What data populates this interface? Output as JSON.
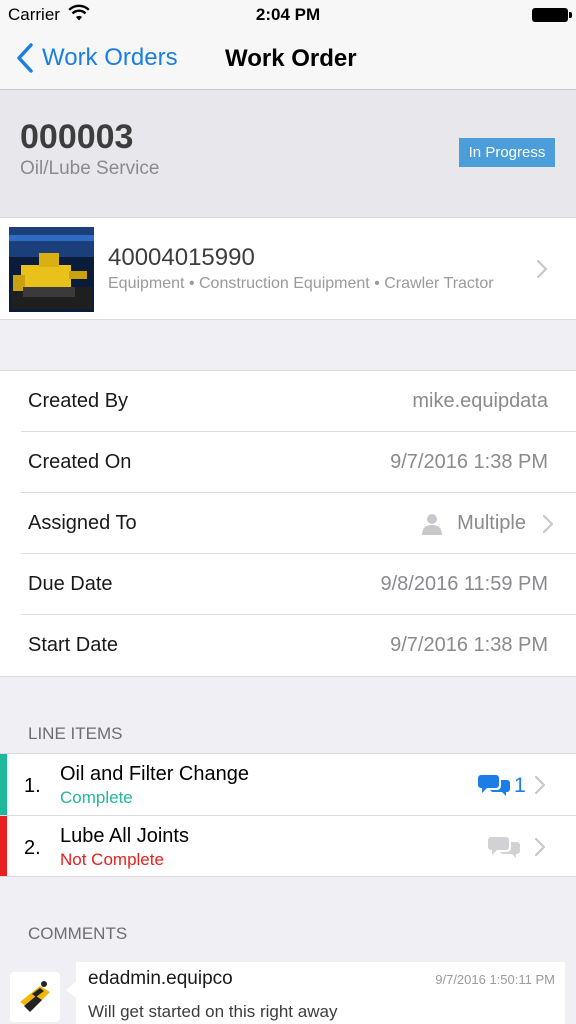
{
  "status_bar": {
    "carrier": "Carrier",
    "time": "2:04 PM"
  },
  "nav": {
    "back_label": "Work Orders",
    "title": "Work Order"
  },
  "work_order": {
    "number": "000003",
    "type": "Oil/Lube Service",
    "status": "In Progress",
    "status_color": "#4b9ed9"
  },
  "asset": {
    "id": "40004015990",
    "path": "Equipment • Construction Equipment • Crawler Tractor"
  },
  "details": {
    "created_by": {
      "label": "Created By",
      "value": "mike.equipdata"
    },
    "created_on": {
      "label": "Created On",
      "value": "9/7/2016 1:38 PM"
    },
    "assigned_to": {
      "label": "Assigned To",
      "value": "Multiple"
    },
    "due_date": {
      "label": "Due Date",
      "value": "9/8/2016 11:59 PM"
    },
    "start_date": {
      "label": "Start Date",
      "value": "9/7/2016 1:38 PM"
    }
  },
  "line_items": {
    "title": "LINE ITEMS",
    "items": [
      {
        "number": "1.",
        "name": "Oil and Filter Change",
        "status": "Complete",
        "status_color": "#1fb89a",
        "comments": "1",
        "icon": "comment-bubbles-icon"
      },
      {
        "number": "2.",
        "name": "Lube All Joints",
        "status": "Not Complete",
        "status_color": "#e8201f",
        "comments": "",
        "icon": "comment-bubbles-icon"
      }
    ]
  },
  "comments": {
    "title": "COMMENTS",
    "items": [
      {
        "author": "edadmin.equipco",
        "timestamp": "9/7/2016 1:50:11 PM",
        "text": "Will get started on this right away"
      }
    ]
  },
  "colors": {
    "accent": "#1a7ee6"
  }
}
